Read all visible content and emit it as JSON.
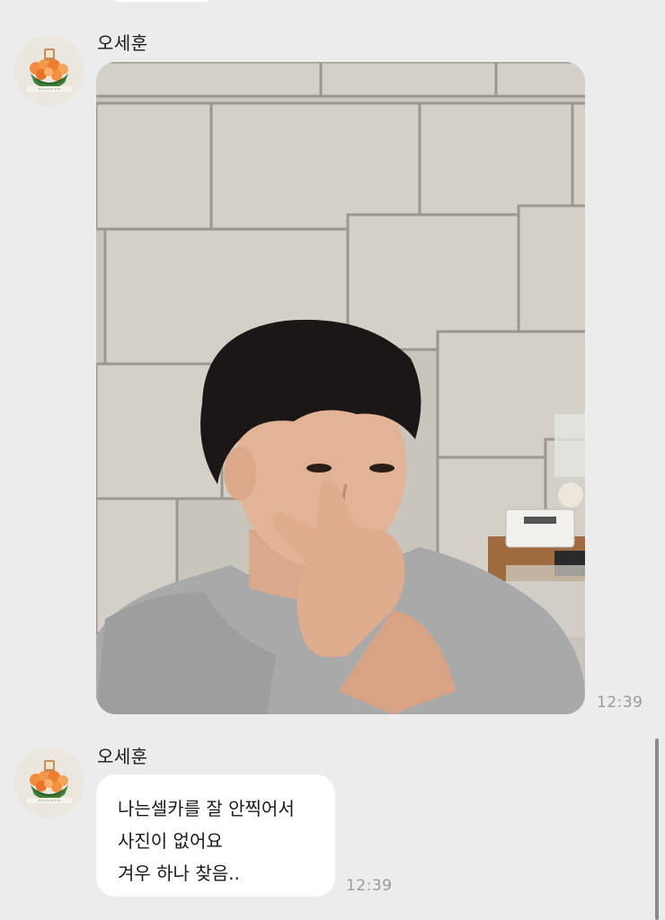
{
  "messages": [
    {
      "sender": "오세훈",
      "type": "image",
      "image_description": "selfie photo",
      "time": "12:39"
    },
    {
      "sender": "오세훈",
      "type": "text",
      "lines": [
        "나는셀카를 잘 안찍어서",
        "사진이 없어요",
        "겨우 하나 찾음.."
      ],
      "time": "12:39"
    }
  ],
  "colors": {
    "background": "#ececec",
    "bubble": "#ffffff",
    "timestamp": "#9a9a9a"
  },
  "icons": {
    "avatar": "avatar-flower-bouquet-icon"
  }
}
